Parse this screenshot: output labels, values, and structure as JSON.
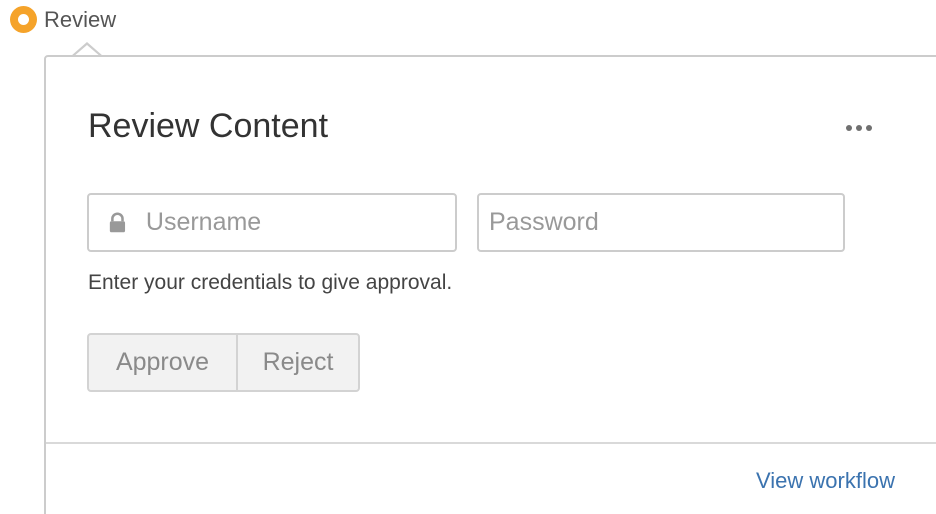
{
  "status": {
    "icon": "status-circle-icon",
    "color": "#f5a32a",
    "label": "Review"
  },
  "dialog": {
    "title": "Review Content",
    "more_icon": "ellipsis-icon"
  },
  "form": {
    "username": {
      "placeholder": "Username",
      "value": "",
      "icon": "lock-icon"
    },
    "password": {
      "placeholder": "Password",
      "value": ""
    },
    "hint": "Enter your credentials to give approval."
  },
  "actions": {
    "approve_label": "Approve",
    "reject_label": "Reject"
  },
  "footer": {
    "link_label": "View workflow",
    "link_color": "#3b73af"
  }
}
